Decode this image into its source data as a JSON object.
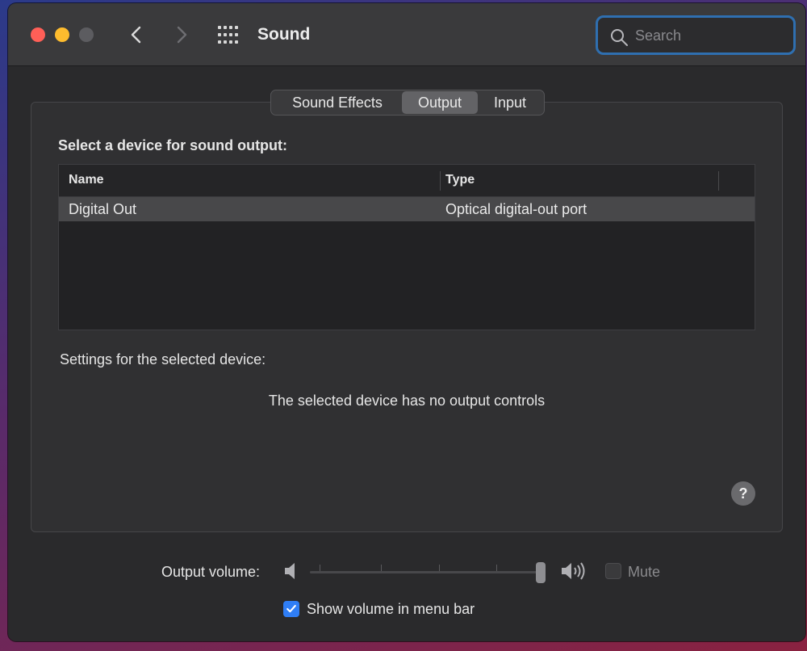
{
  "window": {
    "title": "Sound",
    "traffic_lights": {
      "close": "#ff5f57",
      "minimize": "#febc2e",
      "zoom": "#5c5c60"
    },
    "nav": {
      "back_icon": "chevron-left-icon",
      "forward_icon": "chevron-right-icon",
      "grid_icon": "grid-icon"
    }
  },
  "search": {
    "placeholder": "Search",
    "value": "",
    "focus_color": "#2f6fb0"
  },
  "tabs": [
    {
      "label": "Sound Effects",
      "selected": false
    },
    {
      "label": "Output",
      "selected": true
    },
    {
      "label": "Input",
      "selected": false
    }
  ],
  "output": {
    "section_title": "Select a device for sound output:",
    "table": {
      "columns": [
        "Name",
        "Type"
      ],
      "rows": [
        {
          "name": "Digital Out",
          "type": "Optical digital-out port",
          "selected": true
        }
      ]
    },
    "settings_label": "Settings for the selected device:",
    "no_controls_text": "The selected device has no output controls"
  },
  "footer": {
    "volume_label": "Output volume:",
    "volume_level": 1.0,
    "mute_label": "Mute",
    "mute_checked": false,
    "mute_enabled": false,
    "show_volume_label": "Show volume in menu bar",
    "show_volume_checked": true,
    "accent_color": "#2f7ef6"
  },
  "help_label": "?"
}
